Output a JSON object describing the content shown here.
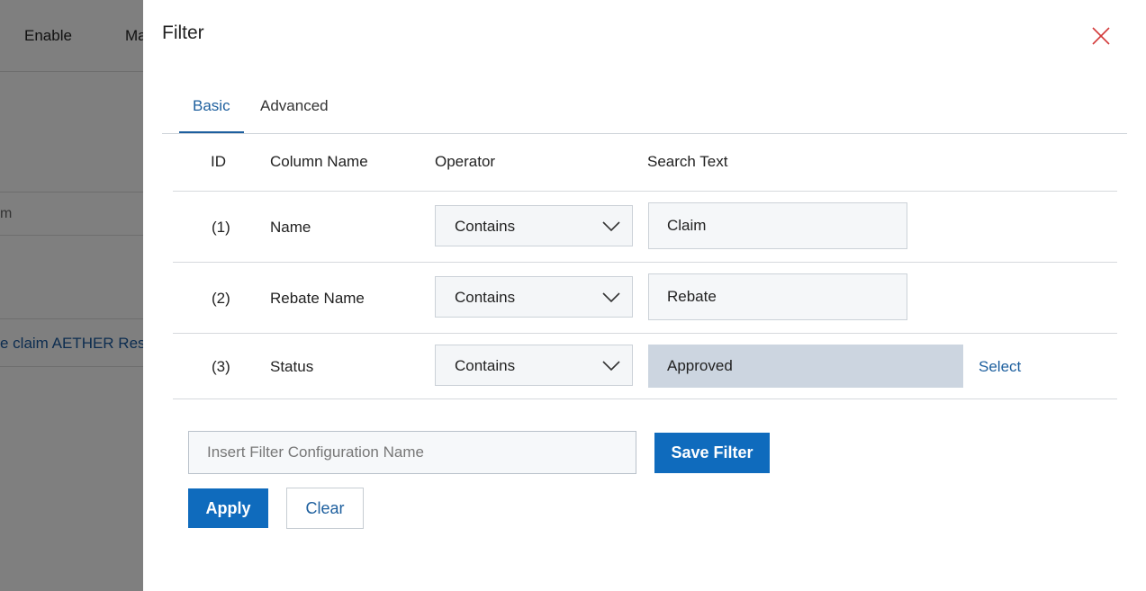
{
  "background": {
    "toolbar": [
      "Enable",
      "Ma"
    ],
    "row_cell_text": "m",
    "row_link_text": "e claim AETHER Res"
  },
  "drawer": {
    "title": "Filter",
    "tabs": [
      {
        "label": "Basic",
        "active": true
      },
      {
        "label": "Advanced",
        "active": false
      }
    ],
    "table": {
      "headers": {
        "id": "ID",
        "column": "Column Name",
        "operator": "Operator",
        "search": "Search Text"
      },
      "rows": [
        {
          "id": "(1)",
          "column": "Name",
          "operator": "Contains",
          "search": "Claim"
        },
        {
          "id": "(2)",
          "column": "Rebate Name",
          "operator": "Contains",
          "search": "Rebate"
        },
        {
          "id": "(3)",
          "column": "Status",
          "operator": "Contains",
          "search": "Approved",
          "action": "Select"
        }
      ]
    },
    "config_placeholder": "Insert Filter Configuration Name",
    "buttons": {
      "save": "Save Filter",
      "apply": "Apply",
      "clear": "Clear"
    }
  },
  "colors": {
    "accent": "#0f6bbd",
    "link": "#1d5f9e",
    "close": "#d33a3a",
    "overlay": "rgba(0,0,0,0.5)"
  }
}
